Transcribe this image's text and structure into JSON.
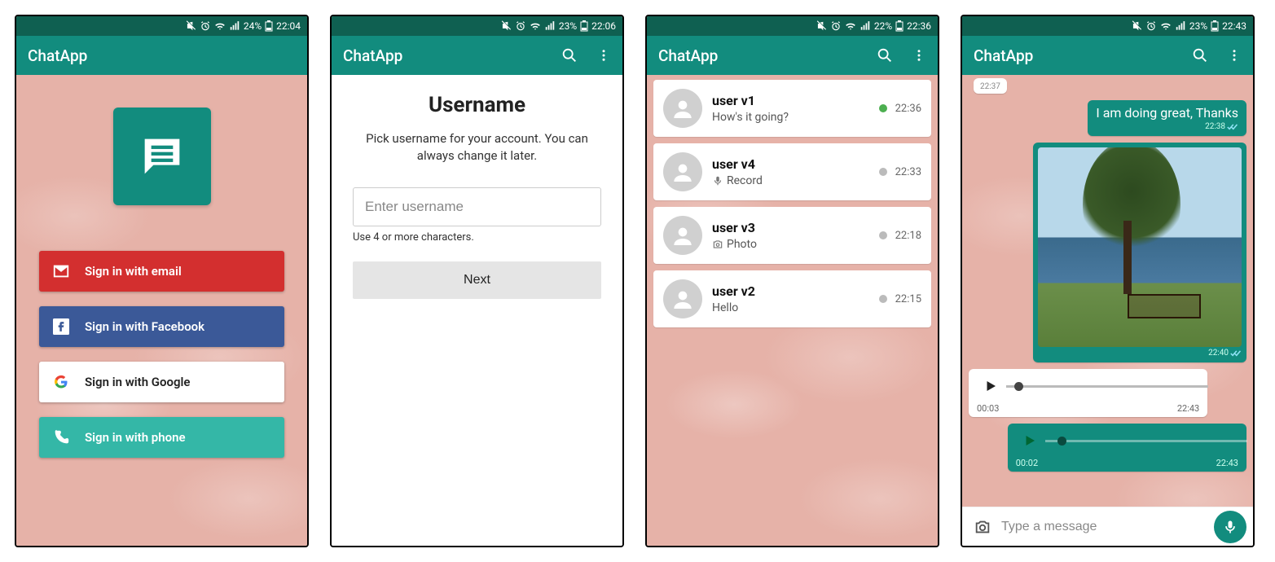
{
  "app_name": "ChatApp",
  "screens": [
    {
      "status": {
        "battery": "24%",
        "time": "22:04"
      },
      "signin": {
        "email": "Sign in with email",
        "facebook": "Sign in with Facebook",
        "google": "Sign in with Google",
        "phone": "Sign in with phone"
      }
    },
    {
      "status": {
        "battery": "23%",
        "time": "22:06"
      },
      "title": "Username",
      "description": "Pick username for your account. You can always change it later.",
      "placeholder": "Enter username",
      "hint": "Use 4 or more characters.",
      "next": "Next"
    },
    {
      "status": {
        "battery": "22%",
        "time": "22:36"
      },
      "chats": [
        {
          "name": "user v1",
          "sub": "How's it going?",
          "icon": "",
          "time": "22:36",
          "online": true
        },
        {
          "name": "user v4",
          "sub": "Record",
          "icon": "mic",
          "time": "22:33",
          "online": false
        },
        {
          "name": "user v3",
          "sub": "Photo",
          "icon": "camera",
          "time": "22:18",
          "online": false
        },
        {
          "name": "user v2",
          "sub": "Hello",
          "icon": "",
          "time": "22:15",
          "online": false
        }
      ]
    },
    {
      "status": {
        "battery": "23%",
        "time": "22:43"
      },
      "messages": {
        "prev_ts": "22:37",
        "text_out": "I am doing great, Thanks",
        "text_out_ts": "22:38",
        "image_ts": "22:40",
        "audio_in": {
          "pos": "00:03",
          "dur": "22:43"
        },
        "audio_out": {
          "pos": "00:02",
          "dur": "22:43"
        }
      },
      "input_placeholder": "Type a message"
    }
  ]
}
